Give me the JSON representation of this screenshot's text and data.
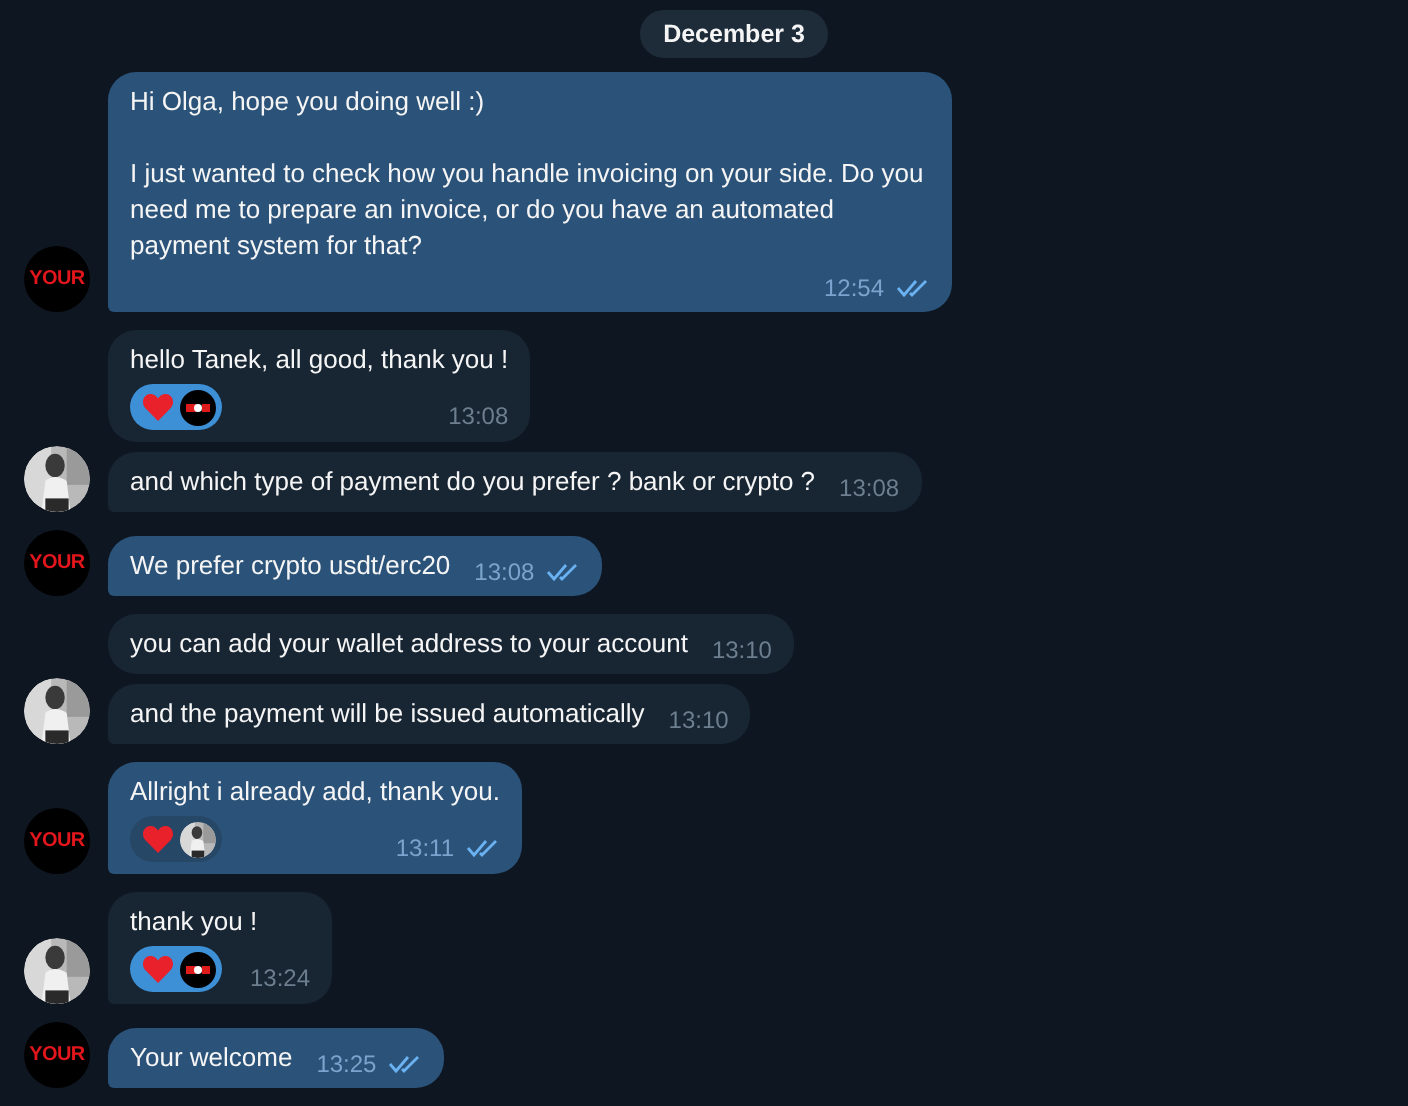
{
  "date": "December 3",
  "messages": [
    {
      "kind": "outgoing",
      "text": "Hi Olga, hope you doing well :)\n\nI just wanted to check how you handle invoicing on your side. Do you need me to prepare an invoice, or do you have an automated payment system for that?",
      "time": "12:54",
      "read": true,
      "avatar": {
        "kind": "logo",
        "text": "YOUR"
      }
    },
    {
      "kind": "incoming",
      "text": "hello Tanek, all good, thank you !",
      "time": "13:08",
      "reaction": {
        "chosen": true,
        "avatar": {
          "kind": "logo"
        }
      }
    },
    {
      "kind": "incoming",
      "text": "and which type of payment do you prefer ? bank or crypto ?",
      "time": "13:08"
    },
    {
      "kind": "outgoing",
      "text": "We prefer crypto usdt/erc20",
      "time": "13:08",
      "read": true,
      "avatar": {
        "kind": "logo",
        "text": "YOUR"
      }
    },
    {
      "kind": "incoming",
      "text": "you can add your wallet address to your account",
      "time": "13:10"
    },
    {
      "kind": "incoming",
      "text": "and the payment will be issued automatically",
      "time": "13:10"
    },
    {
      "kind": "outgoing",
      "text": "Allright i already add, thank you.",
      "time": "13:11",
      "read": true,
      "avatar": {
        "kind": "logo",
        "text": "YOUR"
      },
      "reaction": {
        "chosen": false
      }
    },
    {
      "kind": "incoming",
      "text": "thank you !",
      "time": "13:24",
      "reaction": {
        "chosen": true,
        "avatar": {
          "kind": "logo"
        }
      }
    },
    {
      "kind": "outgoing",
      "text": "Your welcome",
      "time": "13:25",
      "read": true,
      "avatar": {
        "kind": "logo",
        "text": "YOUR"
      }
    }
  ]
}
